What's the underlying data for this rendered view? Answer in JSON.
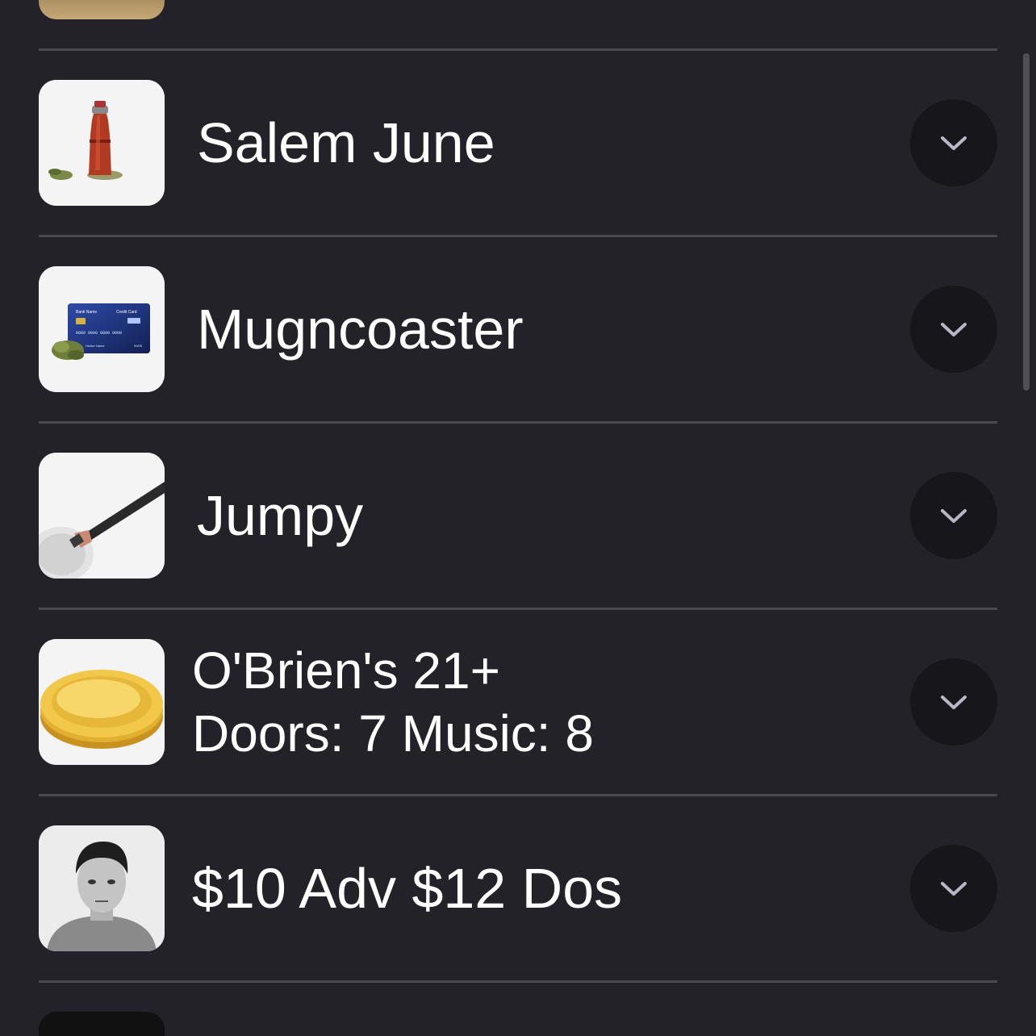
{
  "colors": {
    "background": "#232229",
    "divider": "#4a4950",
    "text": "#ffffff",
    "button_bg": "#17161b",
    "chevron": "#b9b7c6"
  },
  "list": {
    "items": [
      {
        "title": "Salem June",
        "thumbnail": "pepper-mill-image",
        "icon": "chevron-down-icon"
      },
      {
        "title": "Mugncoaster",
        "thumbnail": "credit-card-image",
        "icon": "chevron-down-icon"
      },
      {
        "title": "Jumpy",
        "thumbnail": "pizza-cutter-image",
        "icon": "chevron-down-icon"
      },
      {
        "title_line1": "O'Brien's 21+",
        "title_line2": "Doors: 7 Music: 8",
        "thumbnail": "gold-coin-image",
        "icon": "chevron-down-icon"
      },
      {
        "title": "$10 Adv $12 Dos",
        "thumbnail": "portrait-photo-image",
        "icon": "chevron-down-icon"
      }
    ]
  },
  "card_art": {
    "bank_name": "Bank Name",
    "card_label": "Credit Card",
    "card_number": "0000 0000 0000 0000",
    "holder": "Holder Name",
    "expiry": "00/00"
  }
}
